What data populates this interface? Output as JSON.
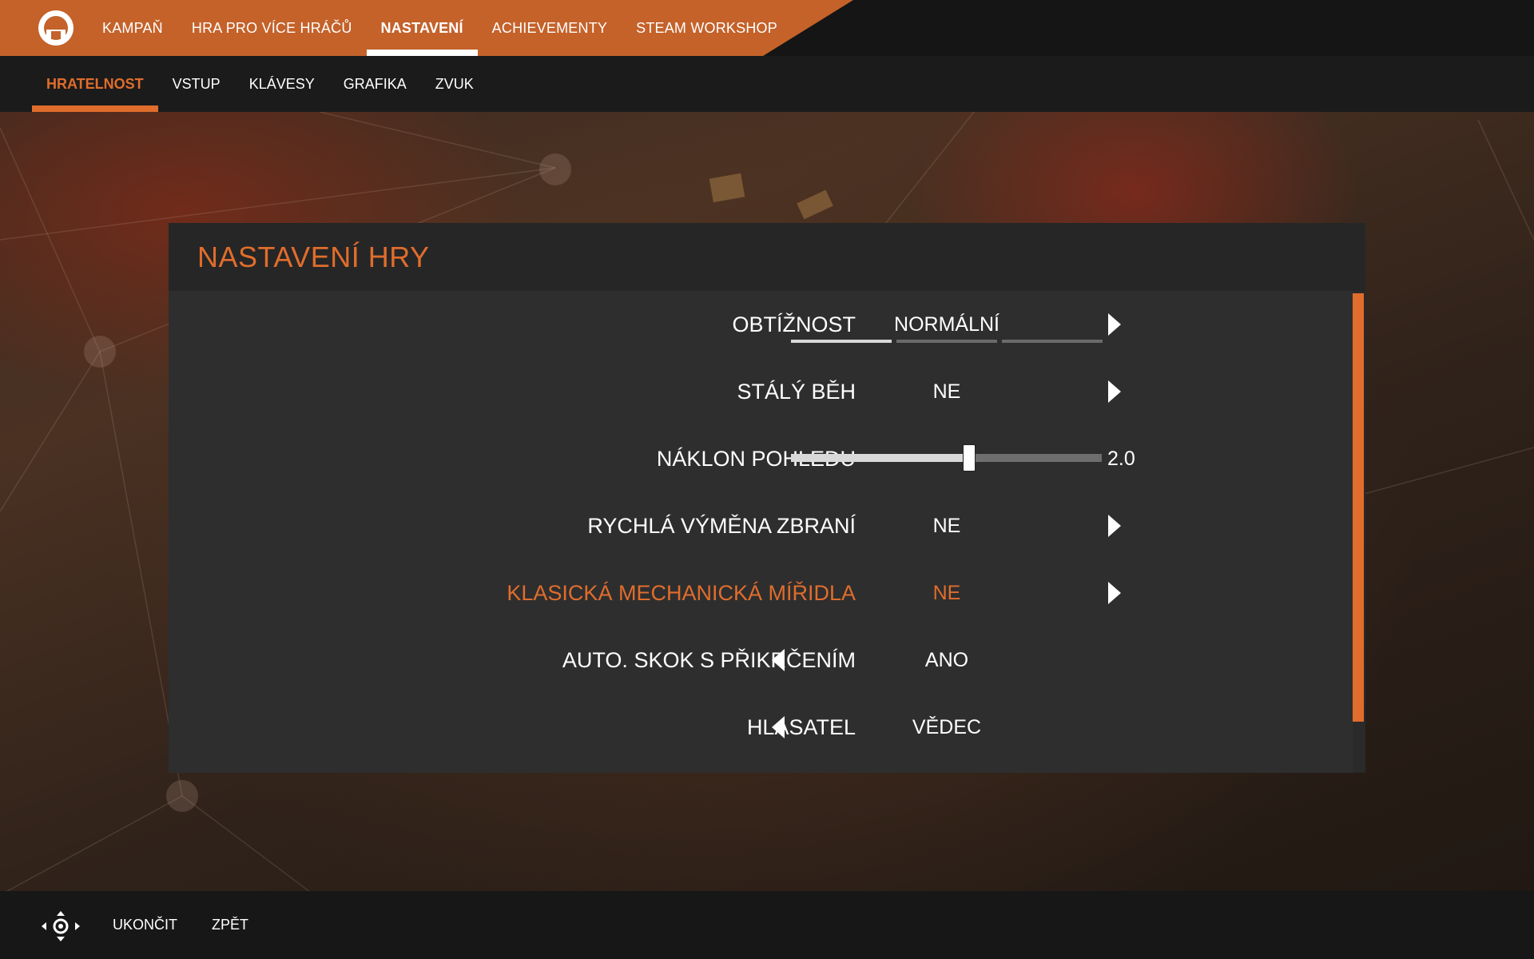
{
  "top_nav": {
    "tabs": [
      {
        "label": "KAMPAŇ",
        "active": false
      },
      {
        "label": "HRA PRO VÍCE HRÁČŮ",
        "active": false
      },
      {
        "label": "NASTAVENÍ",
        "active": true
      },
      {
        "label": "ACHIEVEMENTY",
        "active": false
      },
      {
        "label": "STEAM WORKSHOP",
        "active": false
      }
    ]
  },
  "sub_nav": {
    "tabs": [
      {
        "label": "HRATELNOST",
        "active": true
      },
      {
        "label": "VSTUP",
        "active": false
      },
      {
        "label": "KLÁVESY",
        "active": false
      },
      {
        "label": "GRAFIKA",
        "active": false
      },
      {
        "label": "ZVUK",
        "active": false
      }
    ]
  },
  "panel": {
    "title": "NASTAVENÍ HRY",
    "settings": [
      {
        "label": "OBTÍŽNOST",
        "value": "NORMÁLNÍ",
        "type": "segmented",
        "segments_total": 3,
        "segments_filled": 1,
        "arrow": "right"
      },
      {
        "label": "STÁLÝ BĚH",
        "value": "NE",
        "type": "select",
        "arrow": "right"
      },
      {
        "label": "NÁKLON POHLEDU",
        "value": "2.0",
        "type": "slider",
        "fill_fraction": 0.57
      },
      {
        "label": "RYCHLÁ VÝMĚNA ZBRANÍ",
        "value": "NE",
        "type": "select",
        "arrow": "right"
      },
      {
        "label": "KLASICKÁ MECHANICKÁ MÍŘIDLA",
        "value": "NE",
        "type": "select",
        "arrow": "right",
        "highlighted": true
      },
      {
        "label": "AUTO. SKOK S PŘIKRČENÍM",
        "value": "ANO",
        "type": "select",
        "arrow": "left"
      },
      {
        "label": "HLASATEL",
        "value": "VĚDEC",
        "type": "select",
        "arrow": "left"
      }
    ]
  },
  "bottom_bar": {
    "quit_label": "UKONČIT",
    "back_label": "ZPĚT",
    "nav_icon": "dpad-icon"
  },
  "colors": {
    "accent": "#e06d2c",
    "topbar_orange": "#c4622a",
    "panel_bg": "#2e2e2e"
  }
}
